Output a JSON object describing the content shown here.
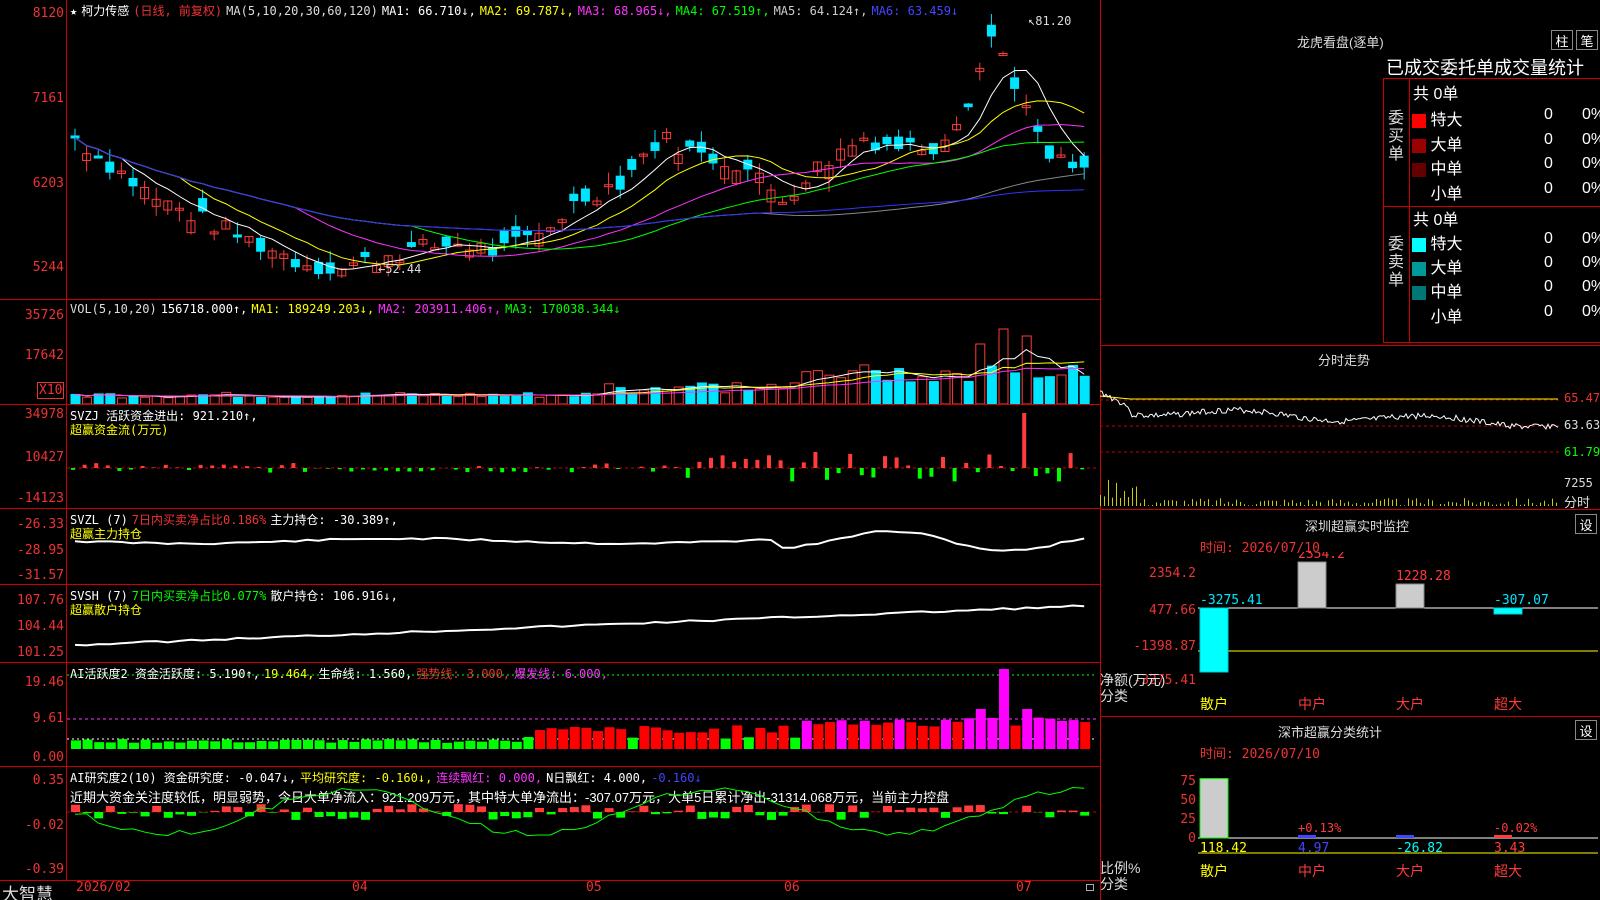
{
  "colors": {
    "up": "#ff3b3b",
    "down": "#00e5ff",
    "ma1": "#ffffff",
    "ma2": "#ffff00",
    "ma3": "#ff33ff",
    "ma4": "#00ff00",
    "ma5": "#888888",
    "ma6": "#3333ff",
    "grid": "#c00000"
  },
  "main": {
    "title": "柯力传感",
    "mode": "(日线, 前复权)",
    "ma_params": "MA(5,10,20,30,60,120)",
    "ma1": "MA1: 66.710↓,",
    "ma2": "MA2: 69.787↓,",
    "ma3": "MA3: 68.965↓,",
    "ma4": "MA4: 67.519↑,",
    "ma5": "MA5: 64.124↑,",
    "ma6": "MA6: 63.459↓",
    "y_ticks": [
      "8120",
      "7161",
      "6203",
      "5244"
    ],
    "high_label": "81.20",
    "low_label": "52.44"
  },
  "vol": {
    "legend": "VOL(5,10,20)",
    "value": "156718.000↑,",
    "ma1": "MA1: 189249.203↓,",
    "ma2": "MA2: 203911.406↑,",
    "ma3": "MA3: 170038.344↓",
    "y_ticks": [
      "35726",
      "17642"
    ],
    "unit": "X10"
  },
  "svzj": {
    "legend": "SVZJ  活跃资金进出: 921.210↑,",
    "sub": "超赢资金流(万元)",
    "y_ticks": [
      "34978",
      "10427",
      "-14123"
    ]
  },
  "svzl": {
    "legend_a": "SVZL (7)",
    "legend_b": "7日内买卖净占比0.186%",
    "legend_c": "主力持仓: -30.389↑,",
    "sub": "超赢主力持仓",
    "y_ticks": [
      "-26.33",
      "-28.95",
      "-31.57"
    ]
  },
  "svsh": {
    "legend_a": "SVSH (7)",
    "legend_b": "7日内买卖净占比0.077%",
    "legend_c": "散户持仓: 106.916↓,",
    "sub": "超赢散户持仓",
    "y_ticks": [
      "107.76",
      "104.44",
      "101.25"
    ]
  },
  "ai1": {
    "legend_a": "AI活跃度2 资金活跃度: 5.190↑,",
    "legend_b": "19.464,",
    "legend_c": "生命线: 1.560,",
    "legend_d": "强势线: 3.000,",
    "legend_e": "爆发线: 6.000,",
    "y_ticks": [
      "19.46",
      "9.61",
      "0.00"
    ]
  },
  "ai2": {
    "legend_a": "AI研究度2(10) 资金研究度: -0.047↓,",
    "legend_b": "平均研究度: -0.160↓,",
    "legend_c": "连续飘红: 0.000,",
    "legend_d": "N日飘红: 4.000,",
    "legend_e": "-0.160↓",
    "note": "近期大资金关注度较低，明显弱势，今日大单净流入：921.209万元，其中特大单净流出：-307.07万元，大单5日累计净出-31314.068万元，当前主力控盘",
    "y_ticks": [
      "0.35",
      "-0.02",
      "-0.39"
    ]
  },
  "xaxis": {
    "brand": "大智慧",
    "labels": [
      "2026/02",
      "04",
      "05",
      "06",
      "07"
    ]
  },
  "right": {
    "lhb": {
      "title": "龙虎看盘(逐单)",
      "btn_bar": "柱",
      "btn_pen": "笔",
      "tabs_text": "已成交委托单成交量统计",
      "buy_label": "委买单",
      "sell_label": "委卖单",
      "buy_total": "共 0单",
      "sell_total": "共 0单",
      "buy_rows": [
        {
          "name": "特大",
          "count": "0",
          "pct": "0%",
          "color": "#ff0000"
        },
        {
          "name": "大单",
          "count": "0",
          "pct": "0%",
          "color": "#990000"
        },
        {
          "name": "中单",
          "count": "0",
          "pct": "0%",
          "color": "#660000"
        },
        {
          "name": "小单",
          "count": "0",
          "pct": "0%",
          "color": ""
        }
      ],
      "sell_rows": [
        {
          "name": "特大",
          "count": "0",
          "pct": "0%",
          "color": "#00ffff"
        },
        {
          "name": "大单",
          "count": "0",
          "pct": "0%",
          "color": "#009999"
        },
        {
          "name": "中单",
          "count": "0",
          "pct": "0%",
          "color": "#007777"
        },
        {
          "name": "小单",
          "count": "0",
          "pct": "0%",
          "color": ""
        }
      ]
    },
    "fenshi": {
      "title": "分时走势",
      "y_ticks": [
        "65.47",
        "63.63",
        "61.79"
      ],
      "vol_label": "7255",
      "vol_unit": "分时"
    },
    "monitor": {
      "title": "深圳超赢实时监控",
      "btn": "设",
      "time": "时间: 2026/07/10",
      "y_ticks": [
        "2354.2",
        "477.66",
        "-1398.87",
        "-3275.41"
      ],
      "axis_label": "净额(万元)",
      "cat_label": "分类",
      "categories": [
        "散户",
        "中户",
        "大户",
        "超大"
      ],
      "values": [
        -3275.41,
        2354.2,
        1228.28,
        -307.07
      ],
      "value_labels": [
        "-3275.41",
        "2354.2",
        "1228.28",
        "-307.07"
      ]
    },
    "classify": {
      "title": "深市超赢分类统计",
      "btn": "设",
      "time": "时间: 2026/07/10",
      "y_ticks": [
        "75",
        "50",
        "25",
        "0"
      ],
      "ratio_label": "比例%",
      "cat_label": "分类",
      "categories": [
        "散户",
        "中户",
        "大户",
        "超大"
      ],
      "values": [
        118.42,
        4.97,
        -26.82,
        3.43
      ],
      "pct_labels": [
        "",
        "+0.13%",
        "",
        "-0.02%"
      ],
      "value_labels": [
        "118.42",
        "4.97",
        "-26.82",
        "3.43"
      ]
    }
  }
}
